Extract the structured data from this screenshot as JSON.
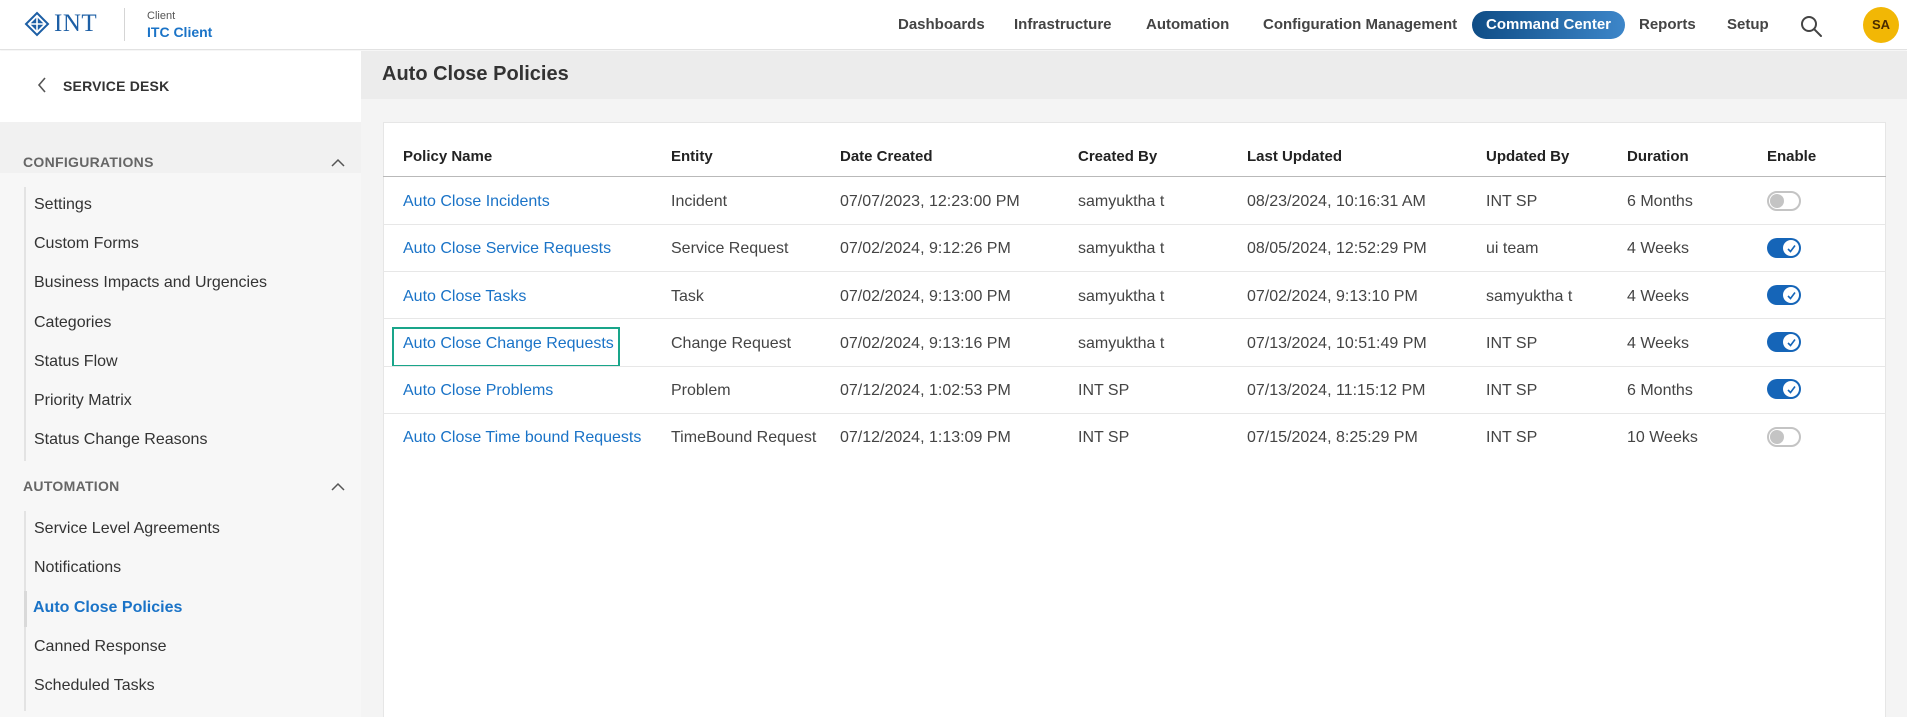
{
  "header": {
    "logo_text": "INT",
    "client_caption": "Client",
    "client_name": "ITC Client",
    "nav": [
      {
        "label": "Dashboards",
        "active": false
      },
      {
        "label": "Infrastructure",
        "active": false
      },
      {
        "label": "Automation",
        "active": false
      },
      {
        "label": "Configuration Management",
        "active": false
      },
      {
        "label": "Command Center",
        "active": true
      },
      {
        "label": "Reports",
        "active": false
      },
      {
        "label": "Setup",
        "active": false
      }
    ],
    "search_icon": "search-icon",
    "avatar_initials": "SA",
    "avatar_color": "#f2b705",
    "accent_color": "#1a73c7"
  },
  "sidebar": {
    "back_label": "SERVICE DESK",
    "sections": [
      {
        "title": "CONFIGURATIONS",
        "expanded": true,
        "items": [
          {
            "label": "Settings"
          },
          {
            "label": "Custom Forms"
          },
          {
            "label": "Business Impacts and Urgencies"
          },
          {
            "label": "Categories"
          },
          {
            "label": "Status Flow"
          },
          {
            "label": "Priority Matrix"
          },
          {
            "label": "Status Change Reasons"
          }
        ]
      },
      {
        "title": "AUTOMATION",
        "expanded": true,
        "items": [
          {
            "label": "Service Level Agreements"
          },
          {
            "label": "Notifications"
          },
          {
            "label": "Auto Close Policies",
            "active": true
          },
          {
            "label": "Canned Response"
          },
          {
            "label": "Scheduled Tasks"
          }
        ]
      }
    ]
  },
  "main": {
    "title": "Auto Close Policies",
    "table": {
      "columns": [
        "Policy Name",
        "Entity",
        "Date Created",
        "Created By",
        "Last Updated",
        "Updated By",
        "Duration",
        "Enable"
      ],
      "rows": [
        {
          "policy": "Auto Close Incidents",
          "entity": "Incident",
          "date_created": "07/07/2023, 12:23:00 PM",
          "created_by": "samyuktha t",
          "last_updated": "08/23/2024, 10:16:31 AM",
          "updated_by": "INT SP",
          "duration": "6 Months",
          "enabled": false
        },
        {
          "policy": "Auto Close Service Requests",
          "entity": "Service Request",
          "date_created": "07/02/2024, 9:12:26 PM",
          "created_by": "samyuktha t",
          "last_updated": "08/05/2024, 12:52:29 PM",
          "updated_by": "ui team",
          "duration": "4 Weeks",
          "enabled": true
        },
        {
          "policy": "Auto Close Tasks",
          "entity": "Task",
          "date_created": "07/02/2024, 9:13:00 PM",
          "created_by": "samyuktha t",
          "last_updated": "07/02/2024, 9:13:10 PM",
          "updated_by": "samyuktha t",
          "duration": "4 Weeks",
          "enabled": true
        },
        {
          "policy": "Auto Close Change Requests",
          "entity": "Change Request",
          "date_created": "07/02/2024, 9:13:16 PM",
          "created_by": "samyuktha t",
          "last_updated": "07/13/2024, 10:51:49 PM",
          "updated_by": "INT SP",
          "duration": "4 Weeks",
          "enabled": true,
          "focused": true
        },
        {
          "policy": "Auto Close Problems",
          "entity": "Problem",
          "date_created": "07/12/2024, 1:02:53 PM",
          "created_by": "INT SP",
          "last_updated": "07/13/2024, 11:15:12 PM",
          "updated_by": "INT SP",
          "duration": "6 Months",
          "enabled": true
        },
        {
          "policy": "Auto Close Time bound Requests",
          "entity": "TimeBound Request",
          "date_created": "07/12/2024, 1:13:09 PM",
          "created_by": "INT SP",
          "last_updated": "07/15/2024, 8:25:29 PM",
          "updated_by": "INT SP",
          "duration": "10 Weeks",
          "enabled": false
        }
      ]
    }
  }
}
